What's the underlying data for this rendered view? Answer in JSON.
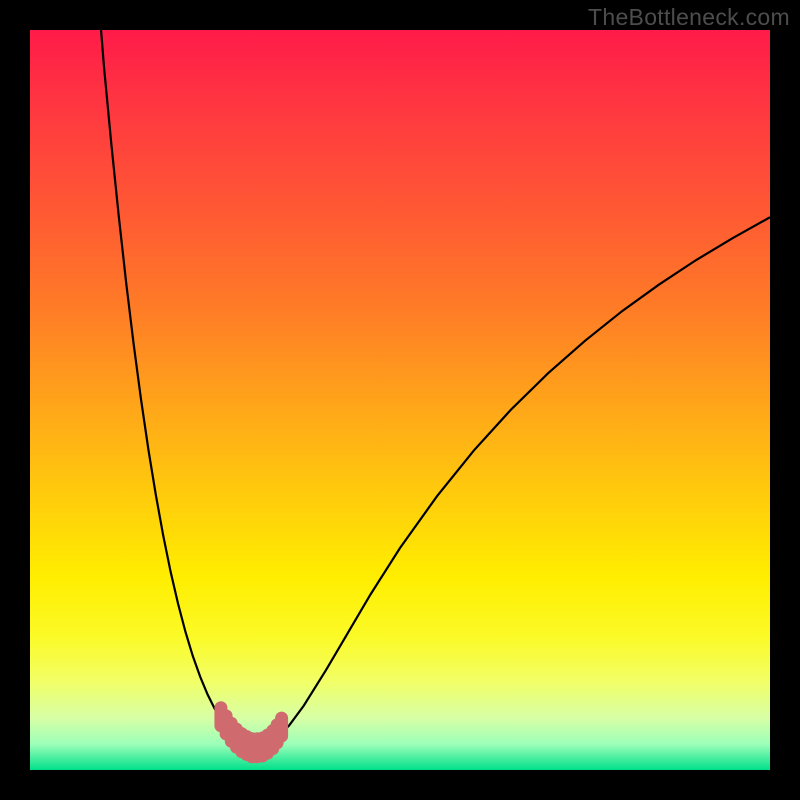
{
  "watermark": "TheBottleneck.com",
  "colors": {
    "frame": "#000000",
    "curve": "#000000",
    "marker_fill": "#cf6b6e",
    "marker_stroke": "#cf6b6e",
    "gradient_stops": [
      {
        "offset": 0.0,
        "color": "#ff1b49"
      },
      {
        "offset": 0.12,
        "color": "#ff3b3f"
      },
      {
        "offset": 0.25,
        "color": "#ff5a33"
      },
      {
        "offset": 0.38,
        "color": "#ff7d26"
      },
      {
        "offset": 0.5,
        "color": "#ffa31a"
      },
      {
        "offset": 0.62,
        "color": "#ffc90d"
      },
      {
        "offset": 0.74,
        "color": "#ffee00"
      },
      {
        "offset": 0.82,
        "color": "#fbfa27"
      },
      {
        "offset": 0.88,
        "color": "#f2ff66"
      },
      {
        "offset": 0.93,
        "color": "#d7ffa6"
      },
      {
        "offset": 0.965,
        "color": "#9cffb9"
      },
      {
        "offset": 1.0,
        "color": "#00e08a"
      }
    ]
  },
  "chart_data": {
    "type": "line",
    "title": "",
    "xlabel": "",
    "ylabel": "",
    "xlim": [
      0,
      100
    ],
    "ylim": [
      0,
      100
    ],
    "grid": false,
    "series": [
      {
        "name": "bottleneck-curve",
        "x": [
          9.6,
          10,
          11,
          12,
          13,
          14,
          15,
          16,
          17,
          18,
          19,
          20,
          21,
          22,
          23,
          24,
          25,
          26,
          27,
          28,
          29,
          30,
          31,
          32,
          33,
          35,
          37,
          40,
          43,
          46,
          50,
          55,
          60,
          65,
          70,
          75,
          80,
          85,
          90,
          95,
          100
        ],
        "values": [
          100,
          95,
          84.5,
          74.8,
          65.8,
          57.6,
          50.1,
          43.3,
          37.2,
          31.7,
          26.8,
          22.5,
          18.7,
          15.4,
          12.6,
          10.2,
          8.2,
          6.6,
          5.3,
          4.2,
          3.5,
          3,
          3,
          3.3,
          4,
          6,
          8.7,
          13.5,
          18.6,
          23.7,
          30,
          37,
          43.2,
          48.7,
          53.6,
          58,
          62,
          65.6,
          68.9,
          71.9,
          74.7
        ]
      }
    ],
    "markers": {
      "name": "highlighted-min-region",
      "x_range": [
        25.8,
        34.0
      ],
      "points": [
        {
          "x": 25.8,
          "y": 7.2
        },
        {
          "x": 26.5,
          "y": 6.1
        },
        {
          "x": 27.2,
          "y": 5.1
        },
        {
          "x": 27.9,
          "y": 4.3
        },
        {
          "x": 28.6,
          "y": 3.7
        },
        {
          "x": 29.3,
          "y": 3.3
        },
        {
          "x": 30.0,
          "y": 3.0
        },
        {
          "x": 30.7,
          "y": 3.0
        },
        {
          "x": 31.4,
          "y": 3.1
        },
        {
          "x": 32.1,
          "y": 3.5
        },
        {
          "x": 32.8,
          "y": 4.1
        },
        {
          "x": 33.4,
          "y": 4.9
        },
        {
          "x": 34.0,
          "y": 5.8
        }
      ]
    }
  }
}
